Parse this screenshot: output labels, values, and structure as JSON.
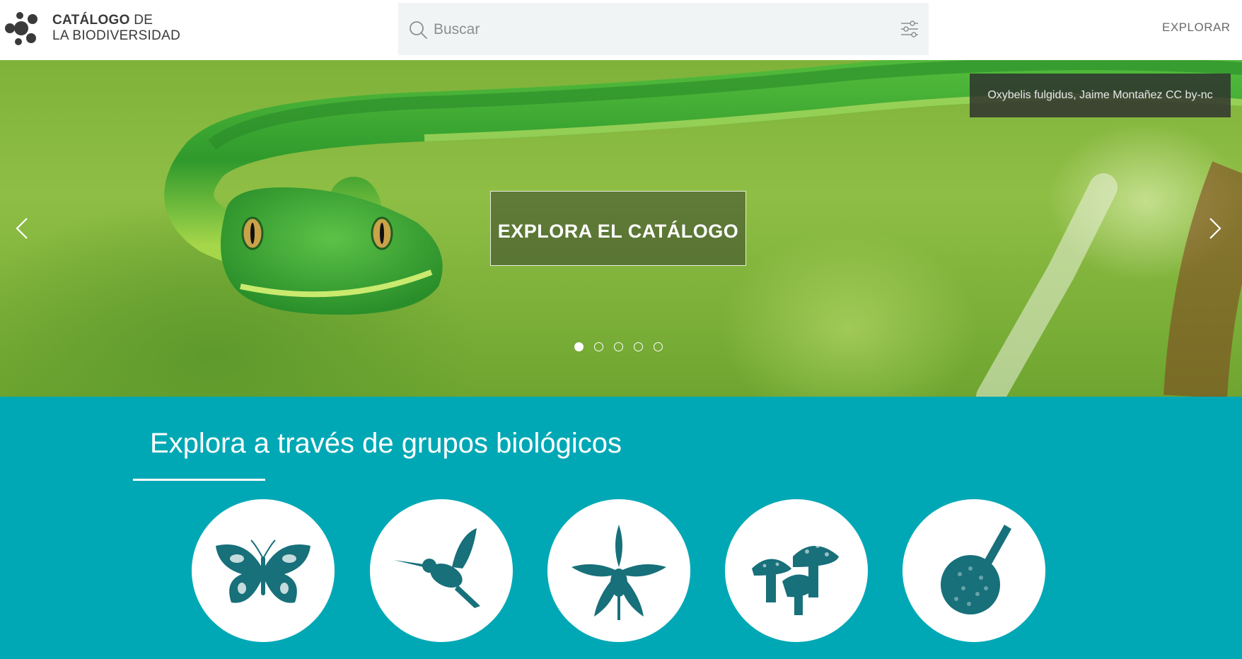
{
  "header": {
    "logo_line1_bold": "CATÁLOGO",
    "logo_line1_rest": " DE",
    "logo_line2": "LA BIODIVERSIDAD",
    "search_placeholder": "Buscar",
    "nav_explorar": "EXPLORAR"
  },
  "hero": {
    "credit": "Oxybelis fulgidus, Jaime Montañez CC by-nc",
    "cta": "EXPLORA EL CATÁLOGO",
    "slides": 5,
    "active_slide": 1
  },
  "groups": {
    "title": "Explora a través de grupos biológicos",
    "items": [
      {
        "icon": "butterfly-icon"
      },
      {
        "icon": "hummingbird-icon"
      },
      {
        "icon": "orchid-icon"
      },
      {
        "icon": "mushroom-icon"
      },
      {
        "icon": "moss-capsule-icon"
      }
    ]
  },
  "colors": {
    "teal": "#00a8b5",
    "icon_teal": "#17707a",
    "dark_text": "#3a3a3a"
  }
}
